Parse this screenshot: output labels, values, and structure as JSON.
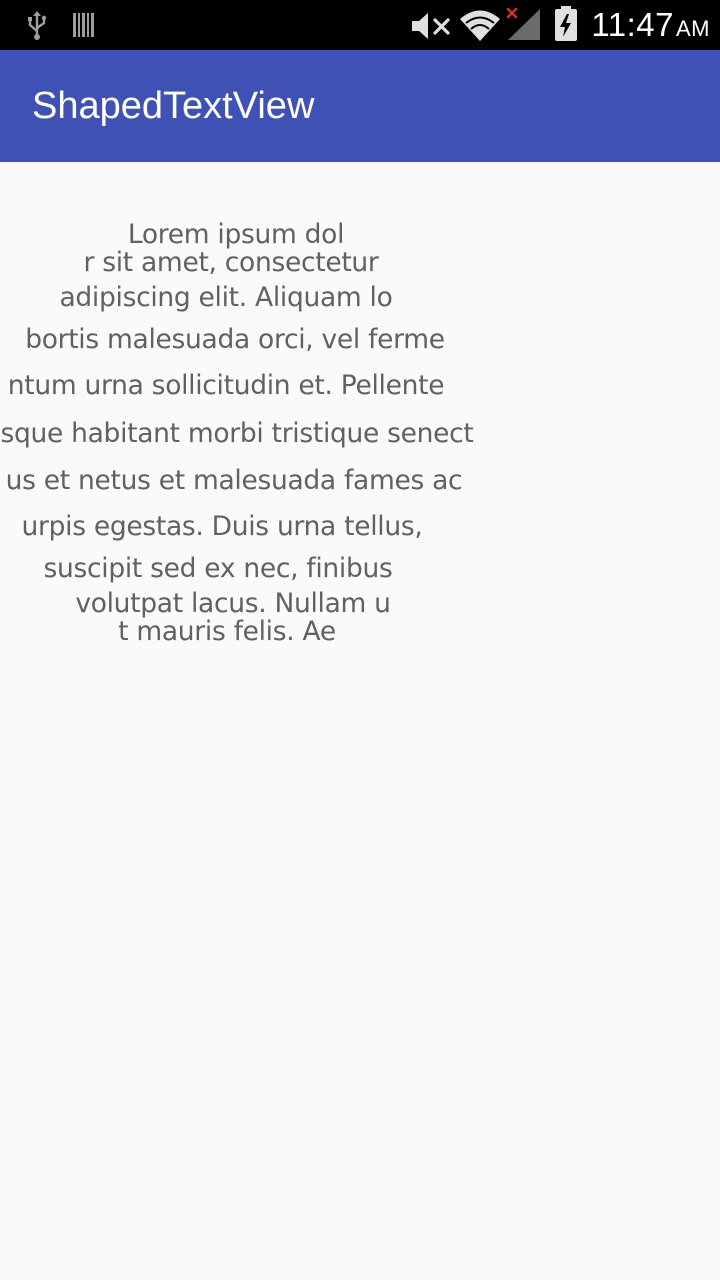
{
  "status_bar": {
    "time": "11:47",
    "ampm": "AM",
    "icons": [
      "usb-icon",
      "barcode-icon",
      "mute-icon",
      "wifi-icon",
      "signal-icon",
      "battery-icon"
    ]
  },
  "app_bar": {
    "title": "ShapedTextView",
    "color": "#3f51b5"
  },
  "shaped_text": {
    "lines": [
      "Lorem ipsum dol",
      "r sit amet, consectetur",
      "adipiscing elit. Aliquam lo",
      "bortis malesuada orci, vel ferme",
      "ntum urna sollicitudin et. Pellente",
      "sque habitant morbi tristique senect",
      "us et netus et malesuada fames ac",
      "urpis egestas. Duis urna tellus,",
      "suscipit sed ex nec, finibus",
      "volutpat lacus. Nullam u",
      "t mauris felis. Ae"
    ],
    "color": "#616161"
  }
}
